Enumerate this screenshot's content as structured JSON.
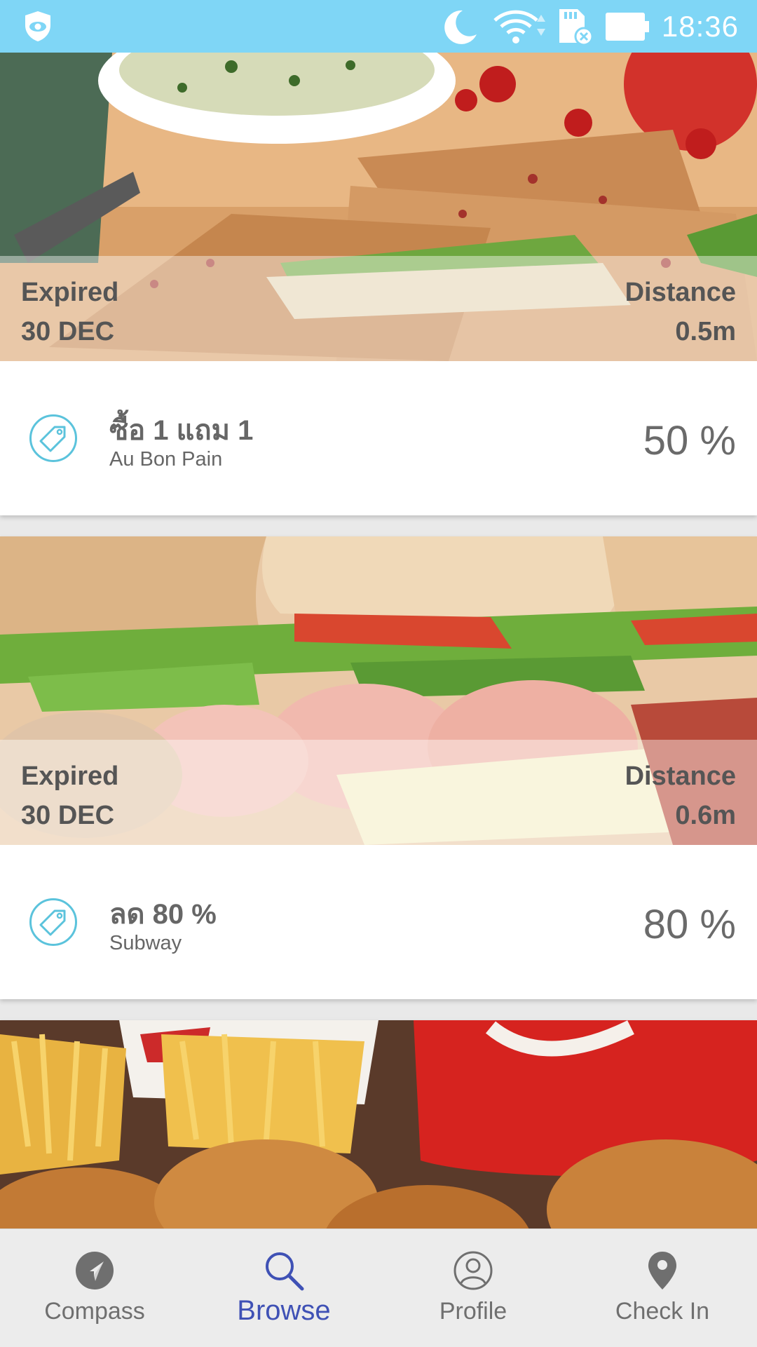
{
  "status_bar": {
    "time": "18:36",
    "icons": [
      "shield-eye-icon",
      "moon-icon",
      "wifi-icon",
      "sd-card-icon",
      "battery-icon"
    ]
  },
  "deals": [
    {
      "expired_label": "Expired",
      "expired_date": "30 DEC",
      "distance_label": "Distance",
      "distance_value": "0.5m",
      "title": "ซื้อ 1 แถม 1",
      "store": "Au Bon Pain",
      "percent": "50 %"
    },
    {
      "expired_label": "Expired",
      "expired_date": "30 DEC",
      "distance_label": "Distance",
      "distance_value": "0.6m",
      "title": "ลด 80 %",
      "store": "Subway",
      "percent": "80 %"
    }
  ],
  "nav": {
    "items": [
      {
        "label": "Compass",
        "icon": "compass-icon"
      },
      {
        "label": "Browse",
        "icon": "search-icon"
      },
      {
        "label": "Profile",
        "icon": "profile-icon"
      },
      {
        "label": "Check In",
        "icon": "location-pin-icon"
      }
    ],
    "active": "Browse"
  },
  "colors": {
    "status_bar": "#7fd6f6",
    "accent": "#3f51b5",
    "tag": "#5bc3dc"
  }
}
